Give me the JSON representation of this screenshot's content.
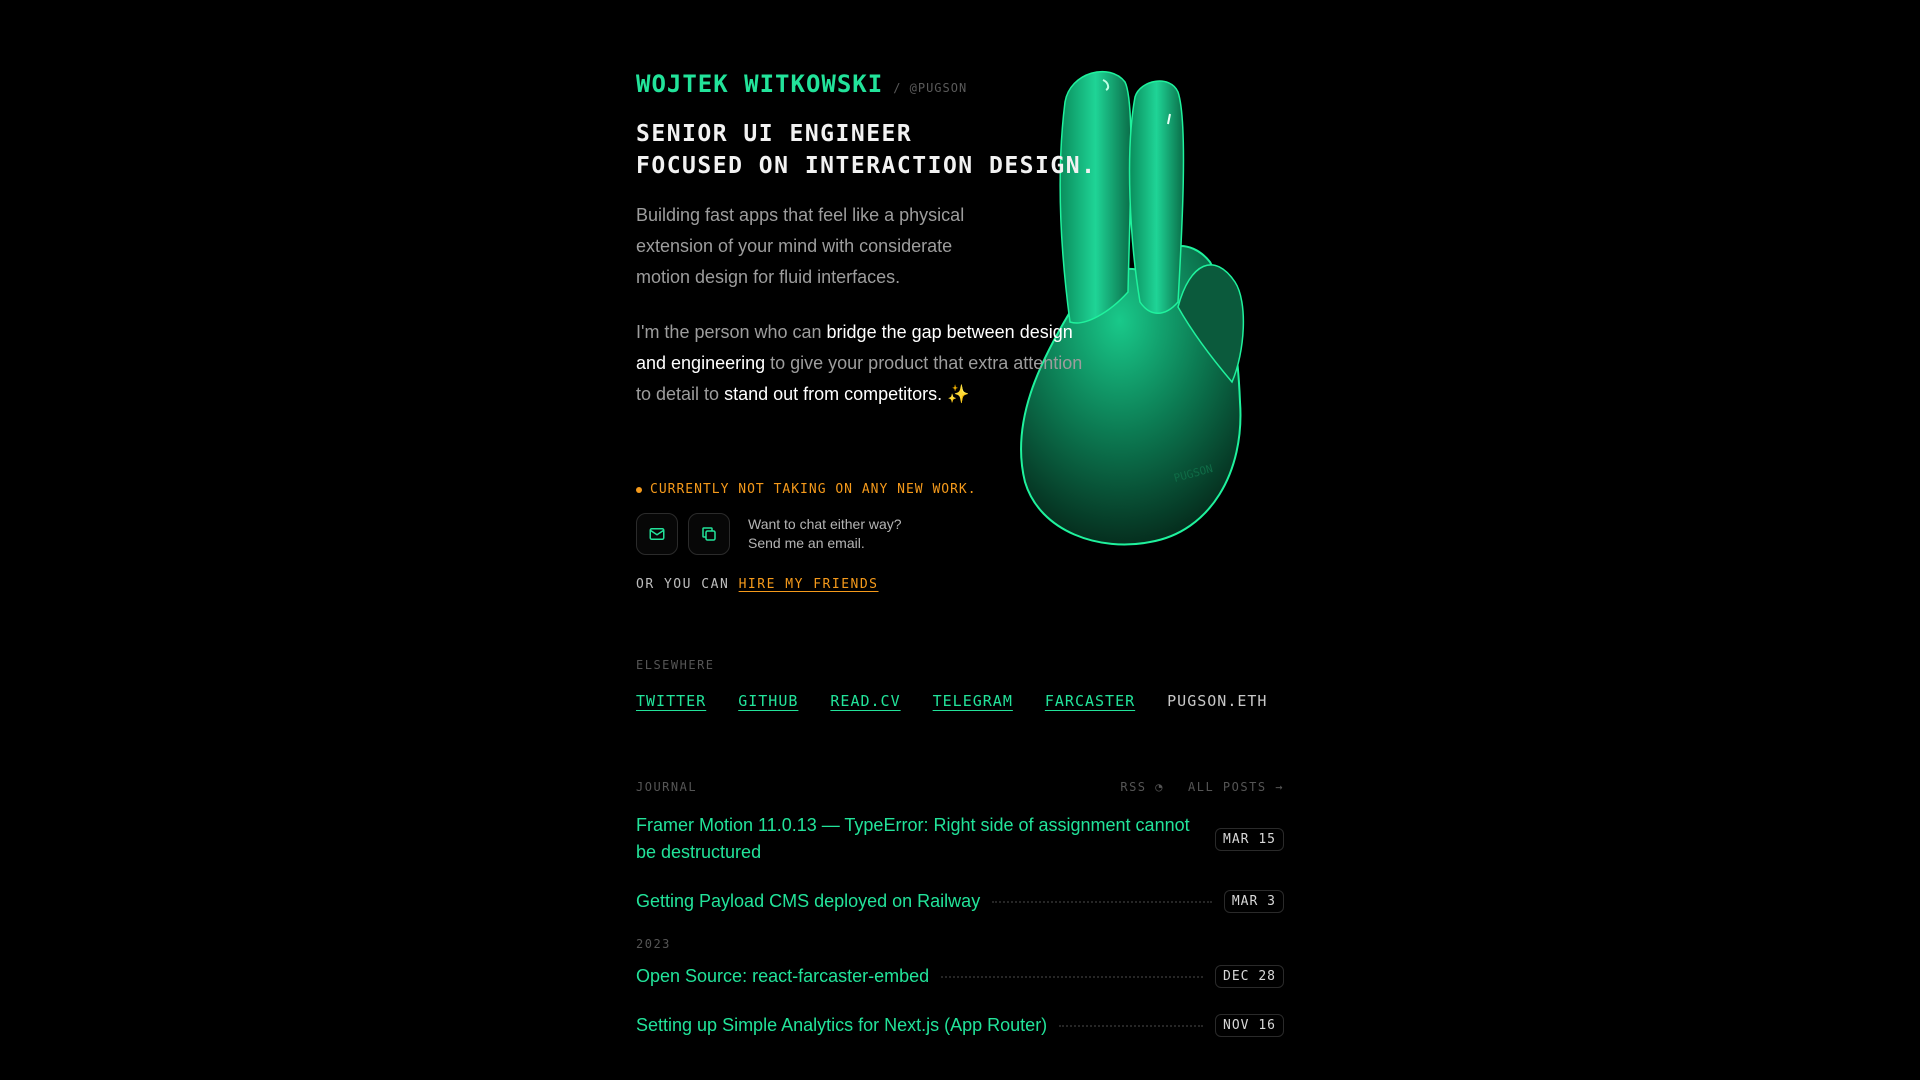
{
  "profile": {
    "name": "WOJTEK WITKOWSKI",
    "handle": "/ @PUGSON",
    "headline_line1": "SENIOR UI ENGINEER",
    "headline_line2": "FOCUSED ON INTERACTION DESIGN.",
    "intro": "Building fast apps that feel like a physical extension of your mind with considerate motion design for fluid interfaces.",
    "about": {
      "p1": "I'm the person who can ",
      "h1": "bridge the gap between design and engineering",
      "p2": " to give your product that extra attention to detail to ",
      "h2": "stand out from competitors.",
      "emoji": "✨"
    }
  },
  "availability": {
    "status": "CURRENTLY NOT TAKING ON ANY NEW WORK.",
    "contact_line1": "Want to chat either way?",
    "contact_line2": "Send me an email.",
    "email_icon": "mail-icon",
    "copy_icon": "copy-icon",
    "friends_prefix": "OR YOU CAN",
    "friends_link": "HIRE MY FRIENDS"
  },
  "elsewhere": {
    "label": "ELSEWHERE",
    "links": [
      "TWITTER",
      "GITHUB",
      "READ.CV",
      "TELEGRAM",
      "FARCASTER"
    ],
    "plain": "PUGSON.ETH"
  },
  "journal": {
    "label": "JOURNAL",
    "rss": "RSS",
    "all_posts": "ALL POSTS →",
    "posts": [
      {
        "title": "Framer Motion 11.0.13 — TypeError: Right side of assignment cannot be destructured",
        "date": "MAR 15"
      },
      {
        "title": "Getting Payload CMS deployed on Railway",
        "date": "MAR 3"
      },
      {
        "title": "Open Source: react-farcaster-embed",
        "date": "DEC 28"
      },
      {
        "title": "Setting up Simple Analytics for Next.js (App Router)",
        "date": "NOV 16"
      }
    ],
    "year": "2023"
  },
  "colors": {
    "accent_green": "#22e39a",
    "accent_orange": "#f59a1b",
    "background": "#000000"
  }
}
